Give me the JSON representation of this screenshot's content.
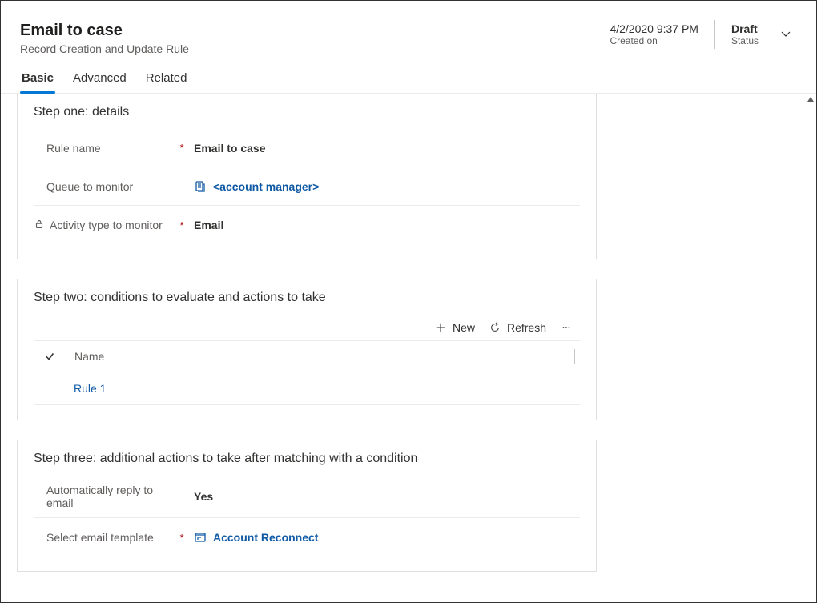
{
  "header": {
    "title": "Email to case",
    "subtitle": "Record Creation and Update Rule",
    "created_on_value": "4/2/2020 9:37 PM",
    "created_on_label": "Created on",
    "status_value": "Draft",
    "status_label": "Status"
  },
  "tabs": {
    "basic": "Basic",
    "advanced": "Advanced",
    "related": "Related"
  },
  "step1": {
    "title": "Step one: details",
    "rule_name_label": "Rule name",
    "rule_name_value": "Email to case",
    "queue_label": "Queue to monitor",
    "queue_value": "<account manager>",
    "activity_type_label": "Activity type to monitor",
    "activity_type_value": "Email"
  },
  "step2": {
    "title": "Step two: conditions to evaluate and actions to take",
    "new_label": "New",
    "refresh_label": "Refresh",
    "col_name": "Name",
    "row1": "Rule 1"
  },
  "step3": {
    "title": "Step three: additional actions to take after matching with a condition",
    "auto_reply_label": "Automatically reply to email",
    "auto_reply_value": "Yes",
    "template_label": "Select email template",
    "template_value": "Account Reconnect"
  }
}
